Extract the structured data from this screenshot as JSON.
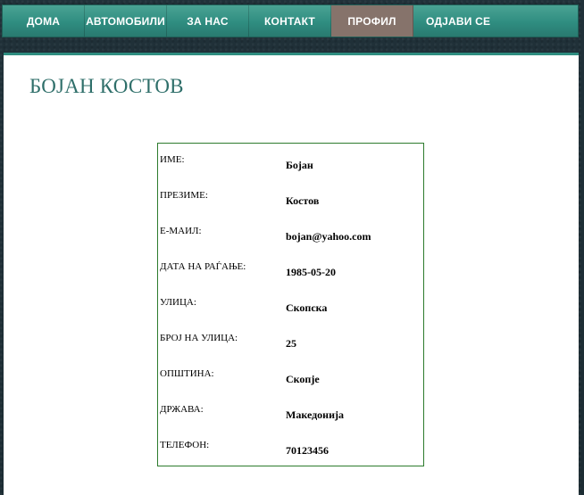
{
  "nav": {
    "items": [
      {
        "label": "ДОМА"
      },
      {
        "label": "АВТОМОБИЛИ"
      },
      {
        "label": "ЗА НАС"
      },
      {
        "label": "КОНТАКТ"
      },
      {
        "label": "ПРОФИЛ",
        "active": true
      },
      {
        "label": "ОДЈАВИ СЕ"
      }
    ]
  },
  "profile": {
    "title": "БОЈАН КОСТОВ",
    "fields": [
      {
        "label": "ИМЕ:",
        "value": "Бојан"
      },
      {
        "label": "ПРЕЗИМЕ:",
        "value": "Костов"
      },
      {
        "label": "Е-МАИЛ:",
        "value": "bojan@yahoo.com"
      },
      {
        "label": "ДАТА НА РАЃАЊЕ:",
        "value": "1985-05-20"
      },
      {
        "label": "УЛИЦА:",
        "value": "Скопска"
      },
      {
        "label": "БРОЈ НА УЛИЦА:",
        "value": "25"
      },
      {
        "label": "ОПШТИНА:",
        "value": "Скопје"
      },
      {
        "label": "ДРЖАВА:",
        "value": "Македонија"
      },
      {
        "label": "ТЕЛЕФОН:",
        "value": "70123456"
      }
    ]
  },
  "colors": {
    "nav_bg": "#2f8d80",
    "nav_active": "#86736b",
    "title": "#2f6f6a",
    "table_border": "#2d7b2d"
  }
}
